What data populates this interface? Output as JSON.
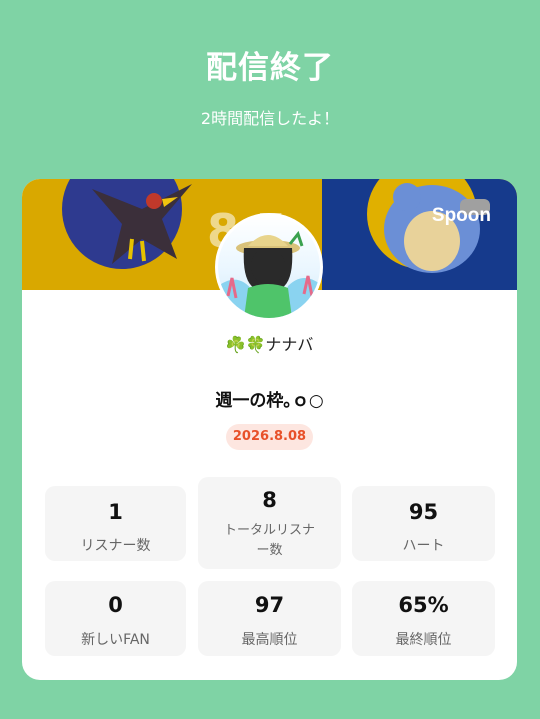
{
  "header": {
    "title": "配信終了",
    "subtitle": "2時間配信したよ！"
  },
  "banner": {
    "logo": "Spoon",
    "number": "8 5"
  },
  "profile": {
    "username": "☘️🍀ナナバ"
  },
  "broadcast": {
    "title": "週一の枠｡ｏ○",
    "date": "2026.8.08"
  },
  "stats": [
    {
      "value": "1",
      "label": "リスナー数"
    },
    {
      "value": "8",
      "label": "トータルリスナー数"
    },
    {
      "value": "95",
      "label": "ハート"
    },
    {
      "value": "0",
      "label": "新しいFAN"
    },
    {
      "value": "97",
      "label": "最高順位"
    },
    {
      "value": "65%",
      "label": "最終順位"
    }
  ],
  "colors": {
    "background": "#7fd3a5",
    "card": "#ffffff",
    "date_text": "#e8512a",
    "date_bg": "#fde6e0"
  }
}
